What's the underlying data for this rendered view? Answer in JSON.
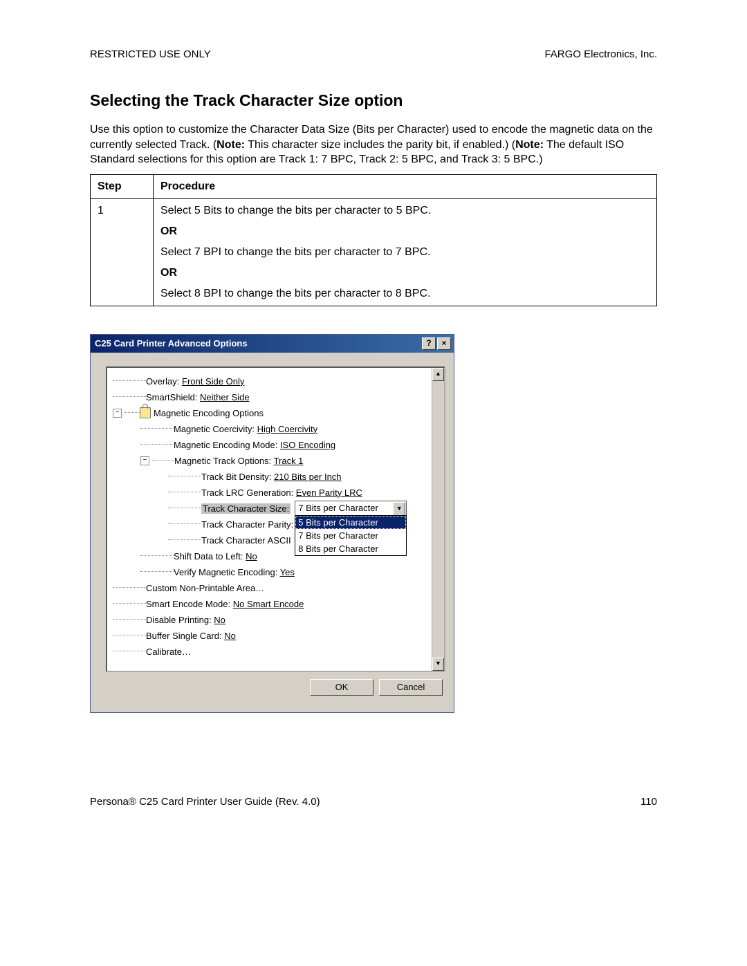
{
  "header": {
    "left": "RESTRICTED USE ONLY",
    "right": "FARGO Electronics, Inc."
  },
  "title": "Selecting the Track Character Size option",
  "intro_parts": {
    "p1": "Use this option to customize the Character Data Size (Bits per Character) used to encode the magnetic data on the currently selected Track.  (",
    "note1_label": "Note:",
    "p2": "  This character size includes the parity bit, if enabled.)   (",
    "note2_label": "Note:",
    "p3": "  The default ISO Standard selections for this option are Track 1: 7 BPC, Track 2: 5 BPC, and Track 3: 5 BPC.)"
  },
  "table": {
    "h1": "Step",
    "h2": "Procedure",
    "step": "1",
    "line1": "Select 5 Bits to change the bits per character to 5 BPC.",
    "or": "OR",
    "line2": "Select 7 BPI to change the bits per character to 7 BPC.",
    "line3": "Select 8 BPI to change the bits per character to 8 BPC."
  },
  "dialog": {
    "title": "C25 Card Printer Advanced Options",
    "tree": {
      "overlay_label": "Overlay: ",
      "overlay_value": "Front Side Only",
      "smartshield_label": "SmartShield: ",
      "smartshield_value": "Neither Side",
      "mag_options": "Magnetic Encoding Options",
      "coerc_label": "Magnetic Coercivity: ",
      "coerc_value": "High Coercivity",
      "mode_label": "Magnetic Encoding Mode: ",
      "mode_value": "ISO Encoding",
      "trackopt_label": "Magnetic Track Options: ",
      "trackopt_value": "Track 1",
      "density_label": "Track Bit Density: ",
      "density_value": "210 Bits per Inch",
      "lrc_label": "Track LRC Generation: ",
      "lrc_value": "Even Parity LRC",
      "charsize_label": "Track Character Size:",
      "dropdown_value": "7 Bits per Character",
      "dd_opt1": "5 Bits per Character",
      "dd_opt2": "7 Bits per Character",
      "dd_opt3": "8 Bits per Character",
      "charparity_label": "Track Character Parity:",
      "charascii_label": "Track Character ASCII",
      "shift_label": "Shift Data to Left: ",
      "shift_value": "No",
      "verify_label": "Verify Magnetic Encoding: ",
      "verify_value": "Yes",
      "custom_np": "Custom Non-Printable Area…",
      "smartenc_label": "Smart Encode Mode: ",
      "smartenc_value": "No Smart Encode",
      "disable_label": "Disable Printing: ",
      "disable_value": "No",
      "buffer_label": "Buffer Single Card: ",
      "buffer_value": "No",
      "calibrate": "Calibrate…"
    },
    "ok": "OK",
    "cancel": "Cancel"
  },
  "footer": {
    "left": "Persona® C25 Card Printer User Guide (Rev. 4.0)",
    "right": "110"
  }
}
